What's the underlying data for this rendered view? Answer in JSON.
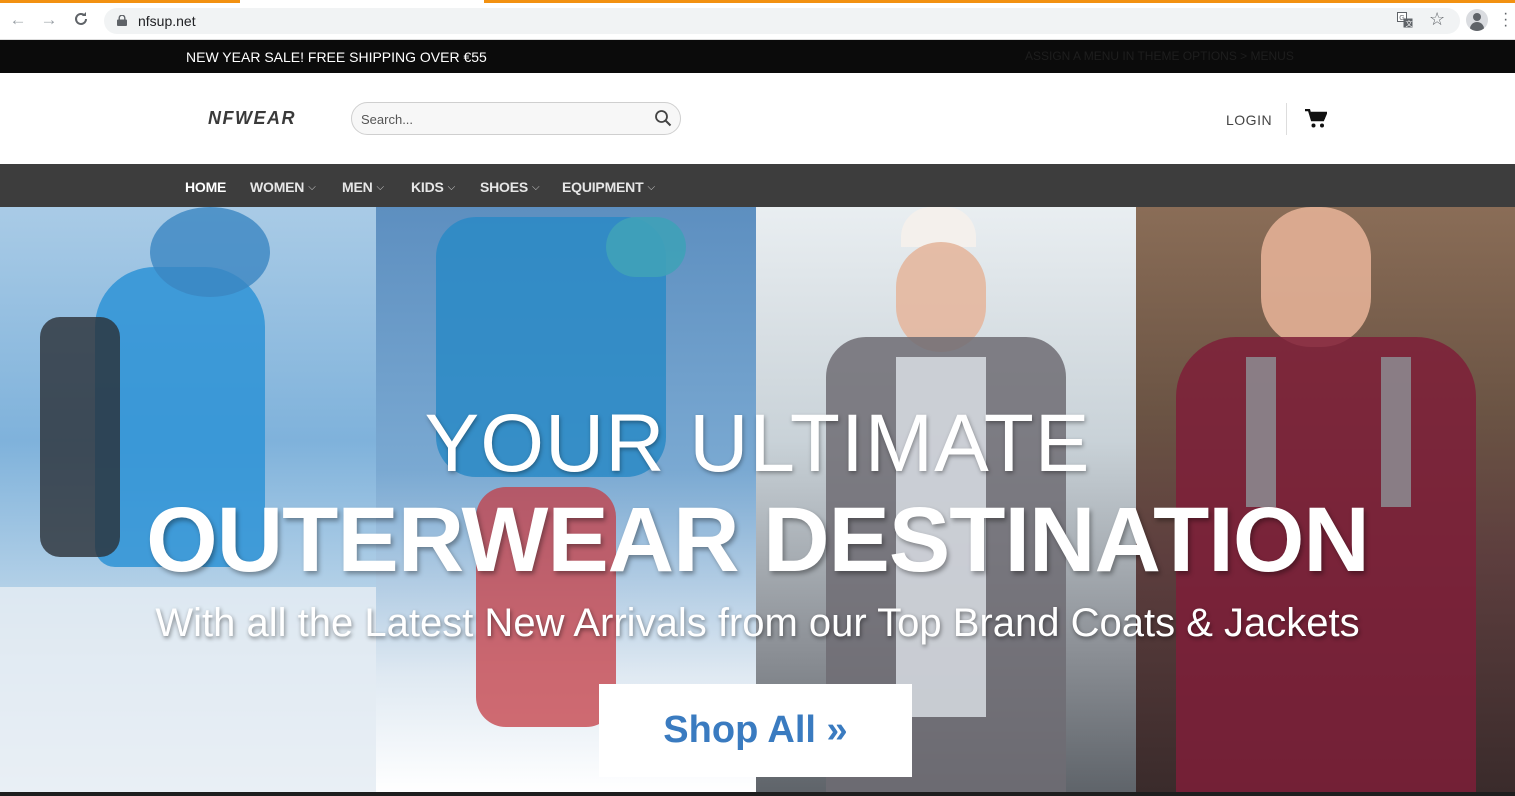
{
  "browser": {
    "url": "nfsup.net",
    "icons": [
      "back-icon",
      "forward-icon",
      "reload-icon",
      "lock-icon",
      "translate-icon",
      "star-icon",
      "profile-icon",
      "menu-icon"
    ]
  },
  "announcement": {
    "text": "NEW YEAR SALE! FREE SHIPPING OVER €55",
    "menu_text": "ASSIGN A MENU IN THEME OPTIONS > MENUS"
  },
  "header": {
    "logo": "NFWEAR",
    "search_placeholder": "Search...",
    "login": "LOGIN"
  },
  "nav": {
    "items": [
      {
        "label": "HOME"
      },
      {
        "label": "WOMEN"
      },
      {
        "label": "MEN"
      },
      {
        "label": "KIDS"
      },
      {
        "label": "SHOES"
      },
      {
        "label": "EQUIPMENT"
      }
    ],
    "chevron": "⌵"
  },
  "hero": {
    "line1": "YOUR ULTIMATE",
    "line2": "OUTERWEAR DESTINATION",
    "line3": "With all the Latest New Arrivals from our Top Brand Coats & Jackets",
    "button": "Shop All »"
  },
  "colors": {
    "accent_loading": "#f29111",
    "announce_bg": "#0b0b0b",
    "nav_bg": "#3d3d3d",
    "button_text": "#3a7bc0"
  }
}
